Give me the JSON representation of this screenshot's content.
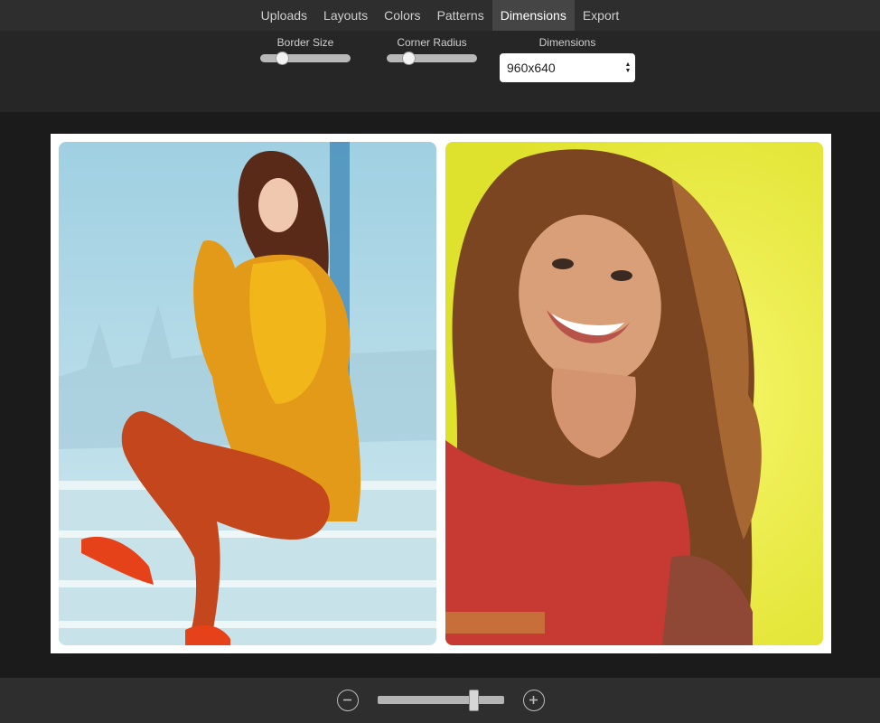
{
  "tabs": [
    {
      "label": "Uploads"
    },
    {
      "label": "Layouts"
    },
    {
      "label": "Colors"
    },
    {
      "label": "Patterns"
    },
    {
      "label": "Dimensions"
    },
    {
      "label": "Export"
    }
  ],
  "active_tab": "Dimensions",
  "controls": {
    "border_size": {
      "label": "Border Size",
      "value_fraction": 0.2
    },
    "corner_radius": {
      "label": "Corner Radius",
      "value_fraction": 0.2
    },
    "dimensions": {
      "label": "Dimensions",
      "selected": "960x640"
    }
  },
  "zoom": {
    "value_fraction": 0.78
  },
  "colors": {
    "collage_border": "#ffffff",
    "photo_left_bg": "#a9d4e4",
    "photo_right_bg": "#e8ea3c"
  },
  "icons": {
    "zoom_out": "minus-circle-icon",
    "zoom_in": "plus-circle-icon",
    "select_arrows": "up-down-arrows-icon"
  }
}
